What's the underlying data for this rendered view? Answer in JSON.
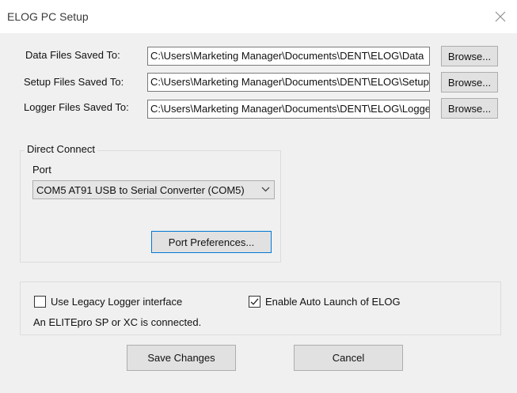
{
  "window": {
    "title": "ELOG PC Setup",
    "close_icon": "close-icon"
  },
  "paths": {
    "data_label": "Data Files Saved To:",
    "data_value": "C:\\Users\\Marketing Manager\\Documents\\DENT\\ELOG\\Data",
    "setup_label": "Setup Files Saved To:",
    "setup_value": "C:\\Users\\Marketing Manager\\Documents\\DENT\\ELOG\\Setup",
    "logger_label": "Logger Files Saved To:",
    "logger_value": "C:\\Users\\Marketing Manager\\Documents\\DENT\\ELOG\\Loggers",
    "browse_label": "Browse..."
  },
  "direct_connect": {
    "legend": "Direct Connect",
    "port_label": "Port",
    "port_value": "COM5 AT91 USB to Serial Converter (COM5)",
    "dropdown_icon": "chevron-down-icon",
    "preferences_label": "Port Preferences..."
  },
  "options": {
    "legacy_label": "Use Legacy Logger interface",
    "legacy_checked": false,
    "autolaunch_label": "Enable Auto Launch of ELOG",
    "autolaunch_checked": true,
    "status_text": "An ELITEpro SP or XC is connected."
  },
  "footer": {
    "save_label": "Save Changes",
    "cancel_label": "Cancel"
  },
  "colors": {
    "dialog_bg": "#f0f0f0",
    "button_bg": "#e1e1e1",
    "focus_border": "#0078d7"
  }
}
